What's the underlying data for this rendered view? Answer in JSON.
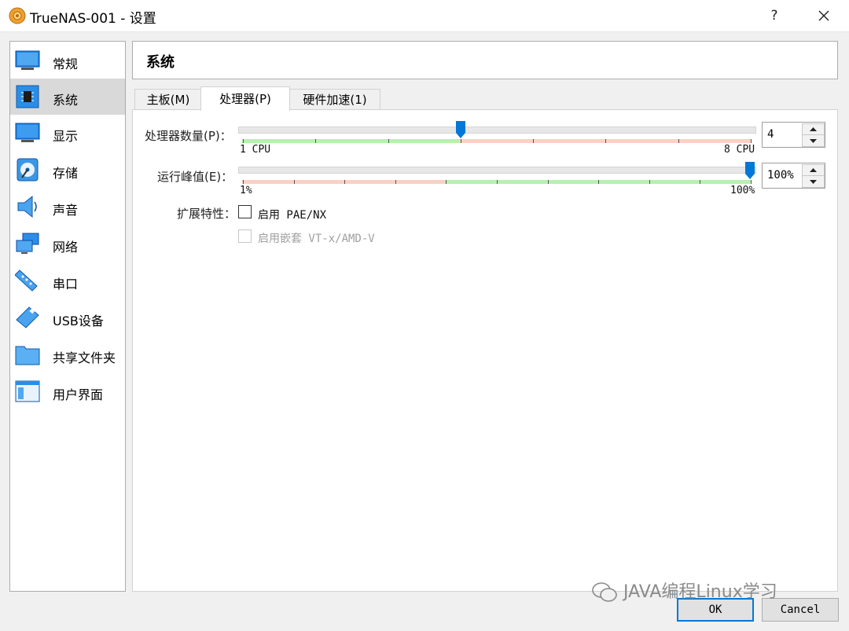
{
  "window": {
    "title": "TrueNAS-001 - 设置",
    "help_label": "?"
  },
  "sidebar": {
    "items": [
      {
        "label": "常规",
        "icon": "general-monitor-icon"
      },
      {
        "label": "系统",
        "icon": "system-chip-icon",
        "selected": true
      },
      {
        "label": "显示",
        "icon": "display-monitor-icon"
      },
      {
        "label": "存储",
        "icon": "storage-disk-icon"
      },
      {
        "label": "声音",
        "icon": "audio-speaker-icon"
      },
      {
        "label": "网络",
        "icon": "network-icon"
      },
      {
        "label": "串口",
        "icon": "serial-port-icon"
      },
      {
        "label": "USB设备",
        "icon": "usb-icon"
      },
      {
        "label": "共享文件夹",
        "icon": "shared-folder-icon"
      },
      {
        "label": "用户界面",
        "icon": "user-interface-icon"
      }
    ]
  },
  "header": {
    "title": "系统"
  },
  "tabs": [
    {
      "label": "主板(M)"
    },
    {
      "label": "处理器(P)",
      "active": true
    },
    {
      "label": "硬件加速(1)"
    }
  ],
  "processor": {
    "count_label": "处理器数量(P)：",
    "count_min_label": "1 CPU",
    "count_max_label": "8 CPU",
    "count_value": "4",
    "count_min": 1,
    "count_max": 8,
    "cap_label": "运行峰值(E)：",
    "cap_min_label": "1%",
    "cap_max_label": "100%",
    "cap_value": "100%",
    "cap_percent": 100,
    "ext_label": "扩展特性：",
    "pae_label": "启用 PAE/NX",
    "pae_checked": false,
    "vtx_label": "启用嵌套 VT-x/AMD-V",
    "vtx_enabled": false
  },
  "buttons": {
    "ok": "OK",
    "cancel": "Cancel"
  },
  "watermark": "JAVA编程Linux学习",
  "colors": {
    "accent": "#0078d7",
    "good_range": "#b7f0b1",
    "bad_range": "#f9d2c4",
    "selected_bg": "#d9d9d9"
  }
}
